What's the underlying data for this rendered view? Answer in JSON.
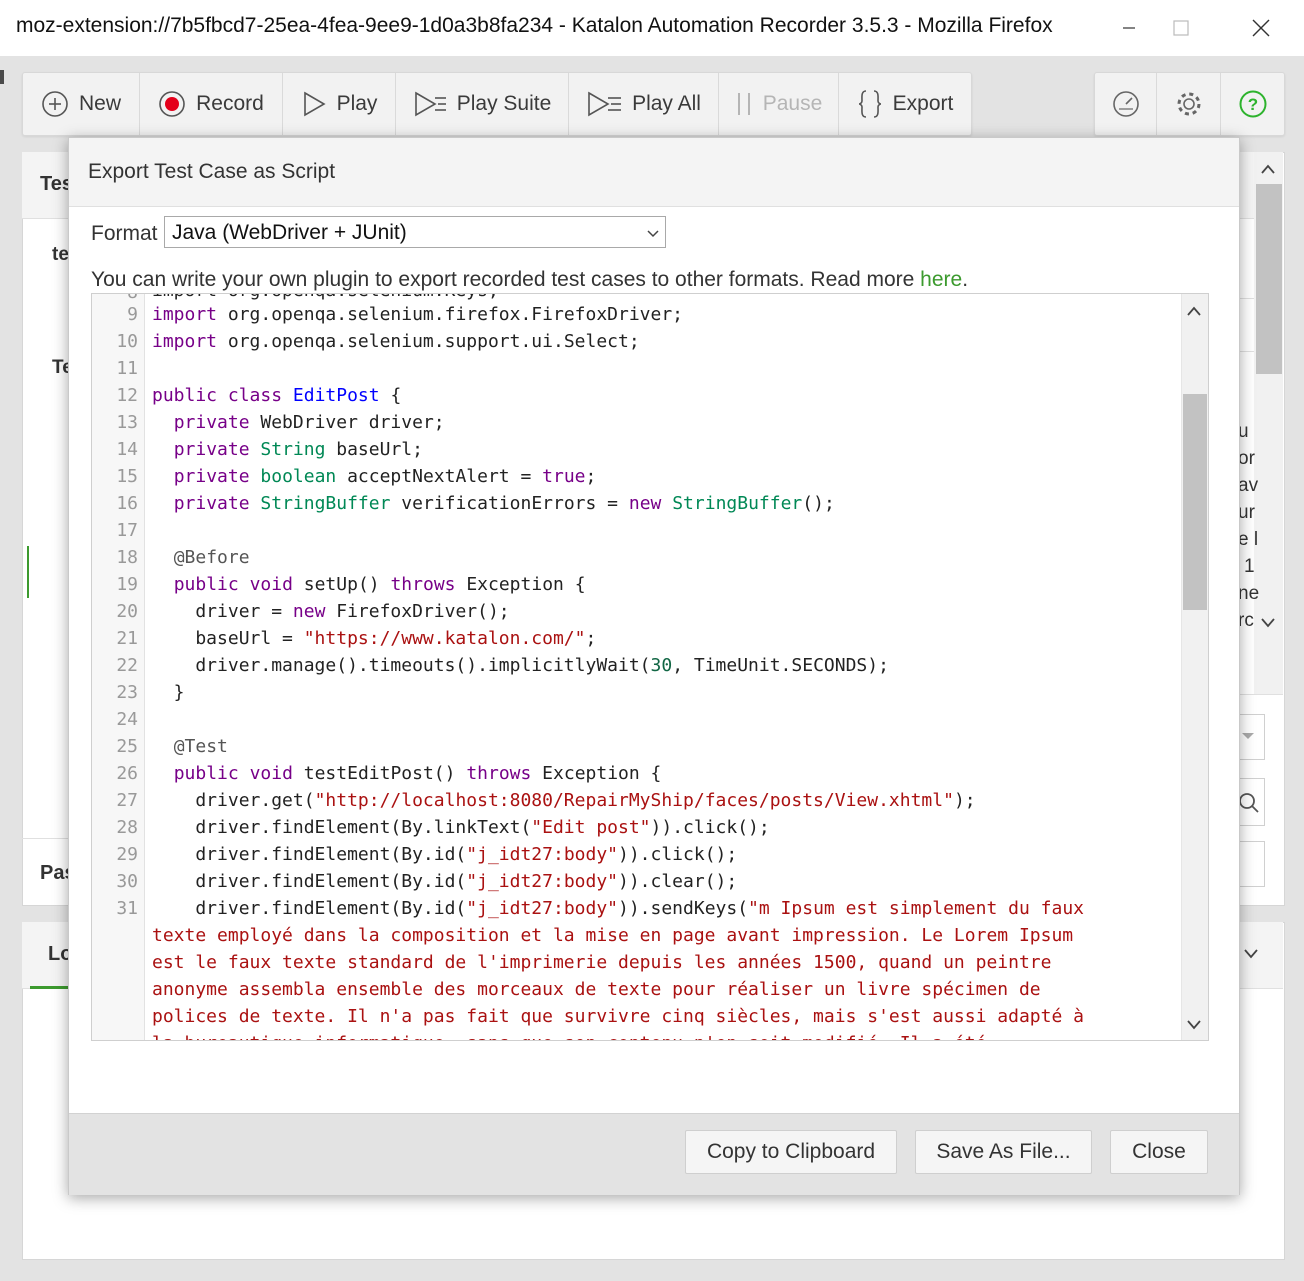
{
  "window": {
    "title": "moz-extension://7b5fbcd7-25ea-4fea-9ee9-1d0a3b8fa234 - Katalon Automation Recorder 3.5.3 - Mozilla Firefox",
    "minimize_icon": "minimize-icon",
    "maximize_icon": "maximize-icon",
    "close_icon": "close-icon"
  },
  "toolbar": {
    "items": [
      {
        "label": "New",
        "icon": "plus-circle-icon"
      },
      {
        "label": "Record",
        "icon": "record-icon"
      },
      {
        "label": "Play",
        "icon": "play-icon"
      },
      {
        "label": "Play Suite",
        "icon": "play-suite-icon"
      },
      {
        "label": "Play All",
        "icon": "play-all-icon"
      },
      {
        "label": "Pause",
        "icon": "pause-icon",
        "disabled": true
      },
      {
        "label": "Export",
        "icon": "braces-icon"
      }
    ],
    "right_icons": [
      "speedometer-icon",
      "gear-icon",
      "help-icon"
    ],
    "help_color": "#2db32d"
  },
  "background": {
    "frag_tes": "Tes",
    "frag_te": "te",
    "frag_t": "Te",
    "frag_pas": "Pas",
    "frag_lo": "Lo",
    "right_frags": [
      "u",
      "or",
      "av",
      "ur",
      "e l",
      "1",
      "ne",
      "rc"
    ]
  },
  "dialog": {
    "title": "Export Test Case as Script",
    "format_label": "Format",
    "format_value": "Java (WebDriver + JUnit)",
    "info_text": "You can write your own plugin to export recorded test cases to other formats. Read more ",
    "info_link": "here",
    "info_end": ".",
    "buttons": {
      "copy": "Copy to Clipboard",
      "save": "Save As File...",
      "close": "Close"
    }
  },
  "code": {
    "line_numbers": [
      "9",
      "10",
      "11",
      "12",
      "13",
      "14",
      "15",
      "16",
      "17",
      "18",
      "19",
      "20",
      "21",
      "22",
      "23",
      "24",
      "25",
      "26",
      "27",
      "28",
      "29",
      "30",
      "31"
    ],
    "top_partial": "import org.openqa.selenium.Keys;",
    "wrap_lines": [
      "texte employé dans la composition et la mise en page avant impression. Le Lorem Ipsum",
      "est le faux texte standard de l'imprimerie depuis les années 1500, quand un peintre",
      "anonyme assembla ensemble des morceaux de texte pour réaliser un livre spécimen de",
      "polices de texte. Il n'a pas fait que survivre cinq siècles, mais s'est aussi adapté à",
      "la bureautique informatique, sans que son contenu n'en soit modifié. Il a été"
    ]
  }
}
